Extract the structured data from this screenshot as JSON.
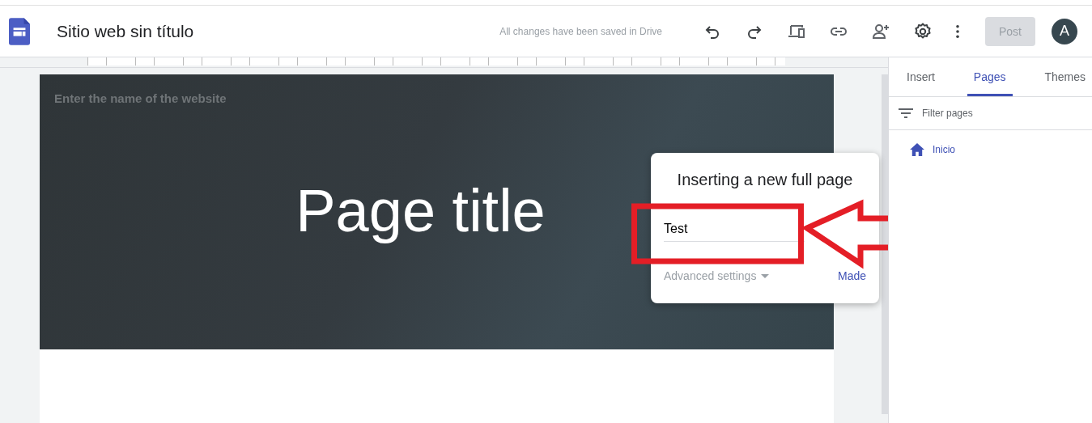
{
  "header": {
    "title": "Sitio web sin título",
    "save_status": "All changes have been saved in Drive",
    "post_button": {
      "label": "Post",
      "disabled": true
    },
    "avatar": "A"
  },
  "hero": {
    "site_name_placeholder": "Enter the name of the website",
    "page_title": "Page title"
  },
  "dialog": {
    "title": "Inserting a new full page",
    "name_value": "Test",
    "advanced": "Advanced settings",
    "done": "Made"
  },
  "tabs": [
    {
      "label": "Insert",
      "selected": false
    },
    {
      "label": "Pages",
      "selected": true
    },
    {
      "label": "Themes",
      "selected": false
    }
  ],
  "filter": {
    "placeholder": "Filter pages"
  },
  "pages": [
    {
      "label": "Inicio",
      "selected": true
    }
  ]
}
